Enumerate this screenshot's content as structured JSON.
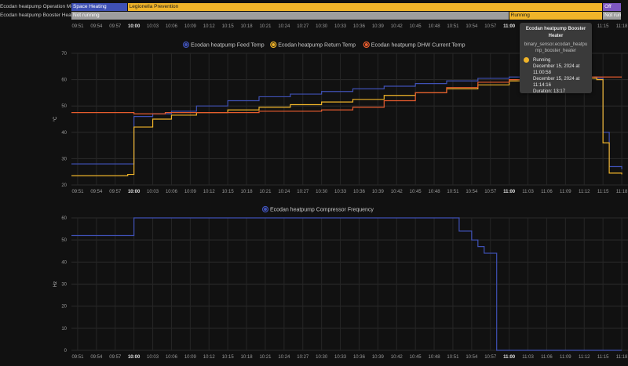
{
  "timeline": {
    "ticks": [
      "09:51",
      "09:54",
      "09:57",
      "10:00",
      "10:03",
      "10:06",
      "10:09",
      "10:12",
      "10:15",
      "10:18",
      "10:21",
      "10:24",
      "10:27",
      "10:30",
      "10:33",
      "10:36",
      "10:39",
      "10:42",
      "10:45",
      "10:48",
      "10:51",
      "10:54",
      "10:57",
      "11:00",
      "11:03",
      "11:06",
      "11:09",
      "11:12",
      "11:15",
      "11:18"
    ],
    "bold_ticks": [
      "10:00",
      "11:00"
    ],
    "rows": [
      {
        "label": "Ecodan heatpump Operation Mode",
        "segments": [
          {
            "label": "Space Heating",
            "start": "09:50",
            "end": "09:59",
            "color": "#3f51b5",
            "text_color": "#ffffff"
          },
          {
            "label": "Legionella Prevention",
            "start": "09:59",
            "end": "11:15",
            "color": "#f0b429",
            "text_color": "#1a1a1a"
          },
          {
            "label": "Off",
            "start": "11:15",
            "end": "11:18",
            "color": "#7e57c2",
            "text_color": "#ffffff"
          }
        ]
      },
      {
        "label": "Ecodan heatpump Booster Heater",
        "segments": [
          {
            "label": "Not running",
            "start": "09:50",
            "end": "11:00",
            "color": "#9e9e9e",
            "text_color": "#ffffff"
          },
          {
            "label": "Running",
            "start": "11:00",
            "end": "11:15",
            "color": "#f0b429",
            "text_color": "#1a1a1a"
          },
          {
            "label": "Not running",
            "start": "11:15",
            "end": "11:18",
            "color": "#9e9e9e",
            "text_color": "#ffffff"
          }
        ]
      }
    ]
  },
  "tooltip": {
    "title": "Ecodan heatpump Booster Heater",
    "entity": "binary_sensor.ecodan_heatpump_booster_heater",
    "state": "Running",
    "from": "December 15, 2024 at 11:00:58",
    "to": "December 15, 2024 at 11:14:16",
    "duration": "Duration: 13:17"
  },
  "chart_data": [
    {
      "type": "line",
      "ylabel": "°C",
      "ylim": [
        20,
        70
      ],
      "yticks": [
        20,
        30,
        40,
        50,
        60,
        70
      ],
      "grid": true,
      "legend_position": "top-center",
      "x_unit": "time",
      "series": [
        {
          "name": "Ecodan heatpump Feed Temp",
          "color": "#3f51b5",
          "step": true,
          "points": [
            [
              "09:50",
              28
            ],
            [
              "09:59",
              28
            ],
            [
              "10:00",
              46
            ],
            [
              "10:03",
              47
            ],
            [
              "10:06",
              48
            ],
            [
              "10:10",
              50
            ],
            [
              "10:15",
              52
            ],
            [
              "10:20",
              53.5
            ],
            [
              "10:25",
              54.5
            ],
            [
              "10:30",
              55.5
            ],
            [
              "10:35",
              56.5
            ],
            [
              "10:40",
              57.5
            ],
            [
              "10:45",
              58.5
            ],
            [
              "10:50",
              59.5
            ],
            [
              "10:55",
              60.5
            ],
            [
              "11:00",
              61
            ],
            [
              "11:05",
              61
            ],
            [
              "11:10",
              61
            ],
            [
              "11:14",
              60.5
            ],
            [
              "11:15",
              40
            ],
            [
              "11:16",
              27
            ],
            [
              "11:18",
              26
            ]
          ]
        },
        {
          "name": "Ecodan heatpump Return Temp",
          "color": "#f0b429",
          "step": true,
          "points": [
            [
              "09:50",
              23.5
            ],
            [
              "09:59",
              24
            ],
            [
              "10:00",
              42
            ],
            [
              "10:03",
              45
            ],
            [
              "10:06",
              46.5
            ],
            [
              "10:10",
              47.5
            ],
            [
              "10:15",
              48.5
            ],
            [
              "10:20",
              49.5
            ],
            [
              "10:25",
              50.5
            ],
            [
              "10:30",
              51.5
            ],
            [
              "10:35",
              52.5
            ],
            [
              "10:40",
              54
            ],
            [
              "10:45",
              55
            ],
            [
              "10:50",
              56.5
            ],
            [
              "10:55",
              58
            ],
            [
              "11:00",
              59.5
            ],
            [
              "11:05",
              60
            ],
            [
              "11:10",
              60.5
            ],
            [
              "11:14",
              60
            ],
            [
              "11:15",
              36
            ],
            [
              "11:16",
              24.5
            ],
            [
              "11:18",
              24
            ]
          ]
        },
        {
          "name": "Ecodan heatpump DHW Current Temp",
          "color": "#e65c2e",
          "step": true,
          "points": [
            [
              "09:50",
              47.5
            ],
            [
              "09:58",
              47.5
            ],
            [
              "10:00",
              47
            ],
            [
              "10:05",
              47.5
            ],
            [
              "10:20",
              48
            ],
            [
              "10:30",
              48.5
            ],
            [
              "10:35",
              49.5
            ],
            [
              "10:40",
              52
            ],
            [
              "10:45",
              55
            ],
            [
              "10:50",
              57
            ],
            [
              "10:55",
              59
            ],
            [
              "11:00",
              60
            ],
            [
              "11:05",
              60.5
            ],
            [
              "11:10",
              61
            ],
            [
              "11:18",
              61
            ]
          ]
        }
      ]
    },
    {
      "type": "line",
      "ylabel": "Hz",
      "ylim": [
        0,
        60
      ],
      "yticks": [
        0,
        10,
        20,
        30,
        40,
        50,
        60
      ],
      "grid": true,
      "legend_position": "top-center",
      "x_unit": "time",
      "series": [
        {
          "name": "Ecodan heatpump Compressor Frequency",
          "color": "#3f51b5",
          "step": true,
          "points": [
            [
              "09:50",
              52
            ],
            [
              "09:59",
              52
            ],
            [
              "10:00",
              60
            ],
            [
              "10:52",
              60
            ],
            [
              "10:52",
              54
            ],
            [
              "10:54",
              50
            ],
            [
              "10:55",
              47
            ],
            [
              "10:56",
              44
            ],
            [
              "10:58",
              44
            ],
            [
              "10:58",
              0
            ],
            [
              "11:18",
              0
            ]
          ]
        }
      ]
    }
  ]
}
